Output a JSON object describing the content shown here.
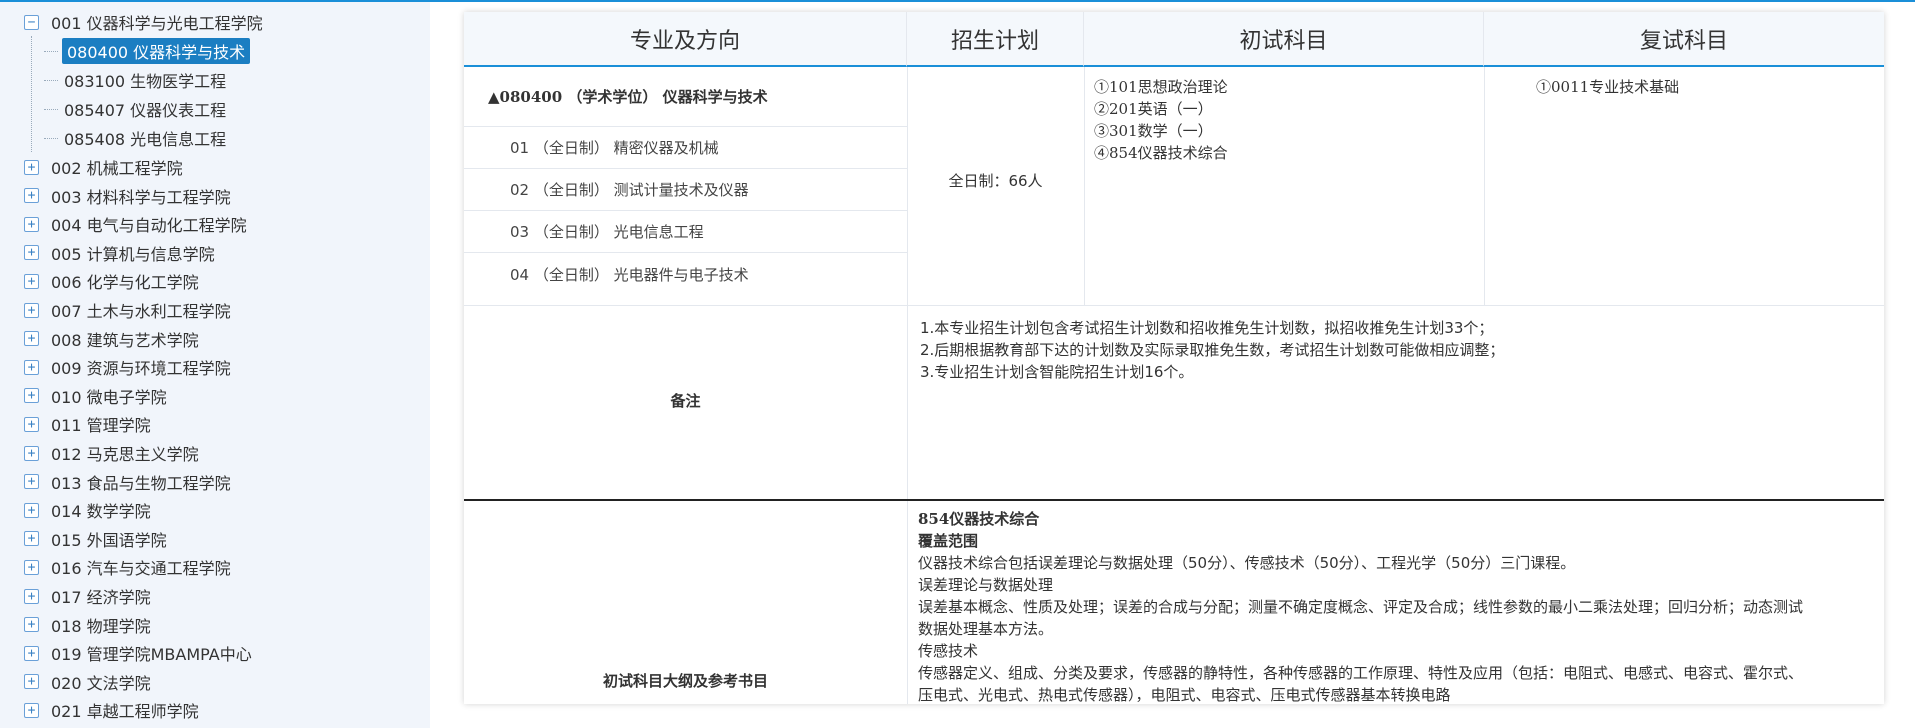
{
  "sidebar": {
    "expanded_college": "001 仪器科学与光电工程学院",
    "majors": [
      {
        "label": "080400 仪器科学与技术",
        "selected": true
      },
      {
        "label": "083100 生物医学工程",
        "selected": false
      },
      {
        "label": "085407 仪器仪表工程",
        "selected": false
      },
      {
        "label": "085408 光电信息工程",
        "selected": false
      }
    ],
    "colleges": [
      "002 机械工程学院",
      "003 材料科学与工程学院",
      "004 电气与自动化工程学院",
      "005 计算机与信息学院",
      "006 化学与化工学院",
      "007 土木与水利工程学院",
      "008 建筑与艺术学院",
      "009 资源与环境工程学院",
      "010 微电子学院",
      "011 管理学院",
      "012 马克思主义学院",
      "013 食品与生物工程学院",
      "014 数学学院",
      "015 外国语学院",
      "016 汽车与交通工程学院",
      "017 经济学院",
      "018 物理学院",
      "019 管理学院MBAMPA中心",
      "020 文法学院",
      "021 卓越工程师学院"
    ],
    "expand_symbol": "+",
    "collapse_symbol": "−"
  },
  "table": {
    "headers": [
      "专业及方向",
      "招生计划",
      "初试科目",
      "复试科目"
    ],
    "major_title": "▲080400 （学术学位） 仪器科学与技术",
    "directions": [
      "01 （全日制） 精密仪器及机械",
      "02 （全日制） 测试计量技术及仪器",
      "03 （全日制） 光电信息工程",
      "04 （全日制） 光电器件与电子技术"
    ],
    "plan": "全日制：66人",
    "exam_subjects": [
      "①101思想政治理论",
      "②201英语（一）",
      "③301数学（一）",
      "④854仪器技术综合"
    ],
    "retest_subjects": [
      "①0011专业技术基础"
    ],
    "remark_label": "备注",
    "remarks": [
      "1.本专业招生计划包含考试招生计划数和招收推免生计划数，拟招收推免生计划33个；",
      "2.后期根据教育部下达的计划数及实际录取推免生数，考试招生计划数可能做相应调整；",
      "3.专业招生计划含智能院招生计划16个。"
    ],
    "outline_label": "初试科目大纲及参考书目",
    "outline": {
      "subject": "854仪器技术综合",
      "scope_title": "覆盖范围",
      "scope_text": "仪器技术综合包括误差理论与数据处理（50分）、传感技术（50分）、工程光学（50分）三门课程。",
      "section1_title": "误差理论与数据处理",
      "section1_text_a": "误差基本概念、性质及处理；误差的合成与分配；测量不确定度概念、评定及合成；线性参数的最小二乘法处理；回归分析；动态测试",
      "section1_text_b": "数据处理基本方法。",
      "section2_title": "传感技术",
      "section2_text_a": "传感器定义、组成、分类及要求，传感器的静特性，各种传感器的工作原理、特性及应用（包括：电阻式、电感式、电容式、霍尔式、",
      "section2_text_b": "压电式、光电式、热电式传感器），电阻式、电容式、压电式传感器基本转换电路"
    }
  },
  "colors": {
    "accent": "#1a8fd8",
    "selected_bg": "#1b7ec2",
    "sidebar_bg": "#f1f5fb"
  }
}
